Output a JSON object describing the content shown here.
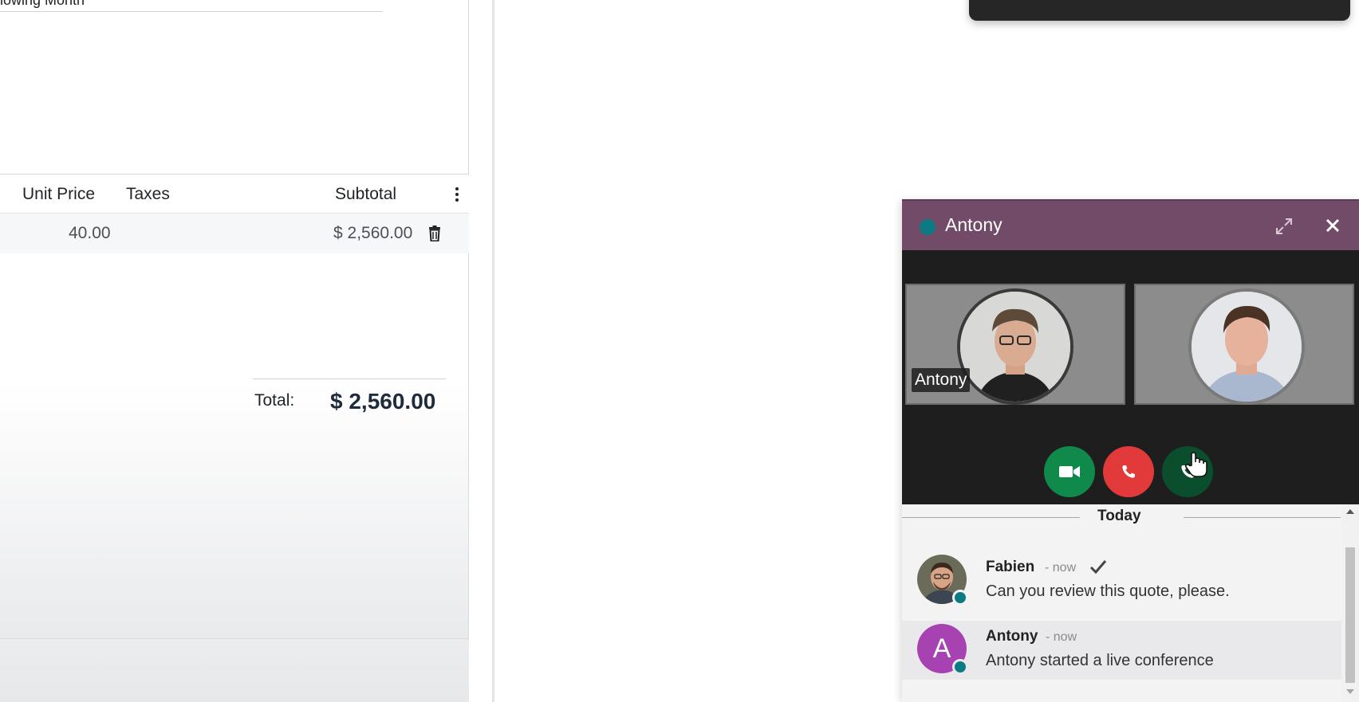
{
  "form": {
    "cut_text": "lowing Month",
    "columns": {
      "unit_price": "Unit Price",
      "taxes": "Taxes",
      "subtotal": "Subtotal"
    },
    "line": {
      "unit_price": "40.00",
      "subtotal": "$ 2,560.00"
    },
    "total_label": "Total:",
    "total_value": "$ 2,560.00"
  },
  "chat": {
    "title": "Antony",
    "status_color": "#0b7a83",
    "header_color": "#714b67",
    "tiles": [
      {
        "name_tag": "Antony"
      },
      {
        "name_tag": ""
      }
    ],
    "controls": [
      "camera-icon",
      "hang-up-icon",
      "phone-icon"
    ],
    "divider_label": "Today",
    "messages": [
      {
        "author": "Fabien",
        "time": "- now",
        "text": "Can you review this quote, please.",
        "avatar": "photo"
      },
      {
        "author": "Antony",
        "time": "- now",
        "text": "Antony started a live conference",
        "avatar_letter": "A",
        "avatar_color": "#a742b3"
      }
    ]
  }
}
